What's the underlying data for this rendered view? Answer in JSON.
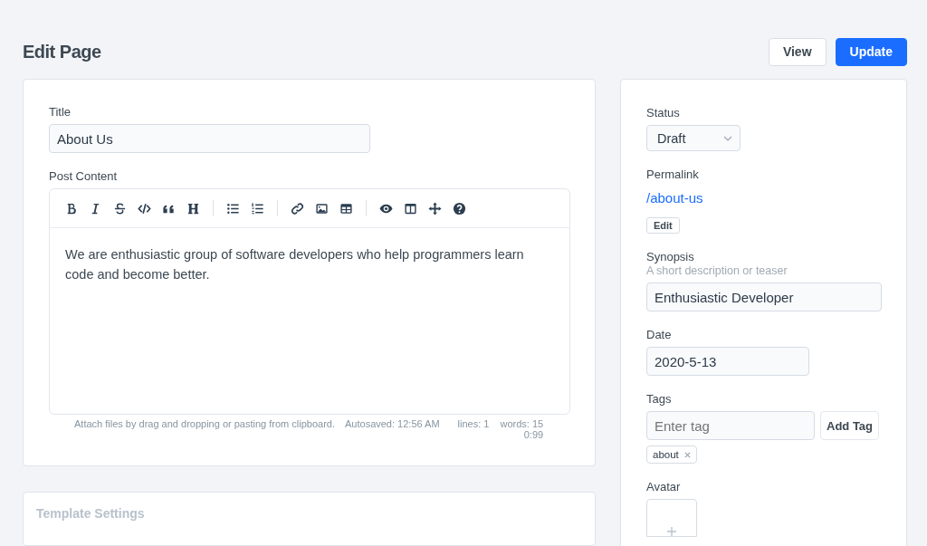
{
  "page": {
    "title": "Edit Page"
  },
  "actions": [
    {
      "label": "View",
      "kind": "secondary"
    },
    {
      "label": "Update",
      "kind": "primary"
    }
  ],
  "main": {
    "title_label": "Title",
    "title_value": "About Us",
    "content_label": "Post Content",
    "content_text": "We are enthusiastic group of software developers who help programmers learn code and become better.",
    "status_bar": {
      "hint": "Attach files by drag and dropping or pasting from clipboard.",
      "autosave": "Autosaved: 12:56 AM",
      "lines": "lines: 1",
      "words": "words: 15",
      "cursor": "0:99"
    }
  },
  "template_settings": {
    "title": "Template Settings"
  },
  "sidebar": {
    "status_label": "Status",
    "status_value": "Draft",
    "permalink_label": "Permalink",
    "permalink": "/about-us",
    "edit_button": "Edit",
    "synopsis_label": "Synopsis",
    "synopsis_hint": "A short description or teaser",
    "synopsis_value": "Enthusiastic Developer",
    "date_label": "Date",
    "date_value": "2020-5-13",
    "tags_label": "Tags",
    "tag_placeholder": "Enter tag",
    "add_tag_button": "Add Tag",
    "tags": [
      "about"
    ],
    "avatar_label": "Avatar"
  }
}
